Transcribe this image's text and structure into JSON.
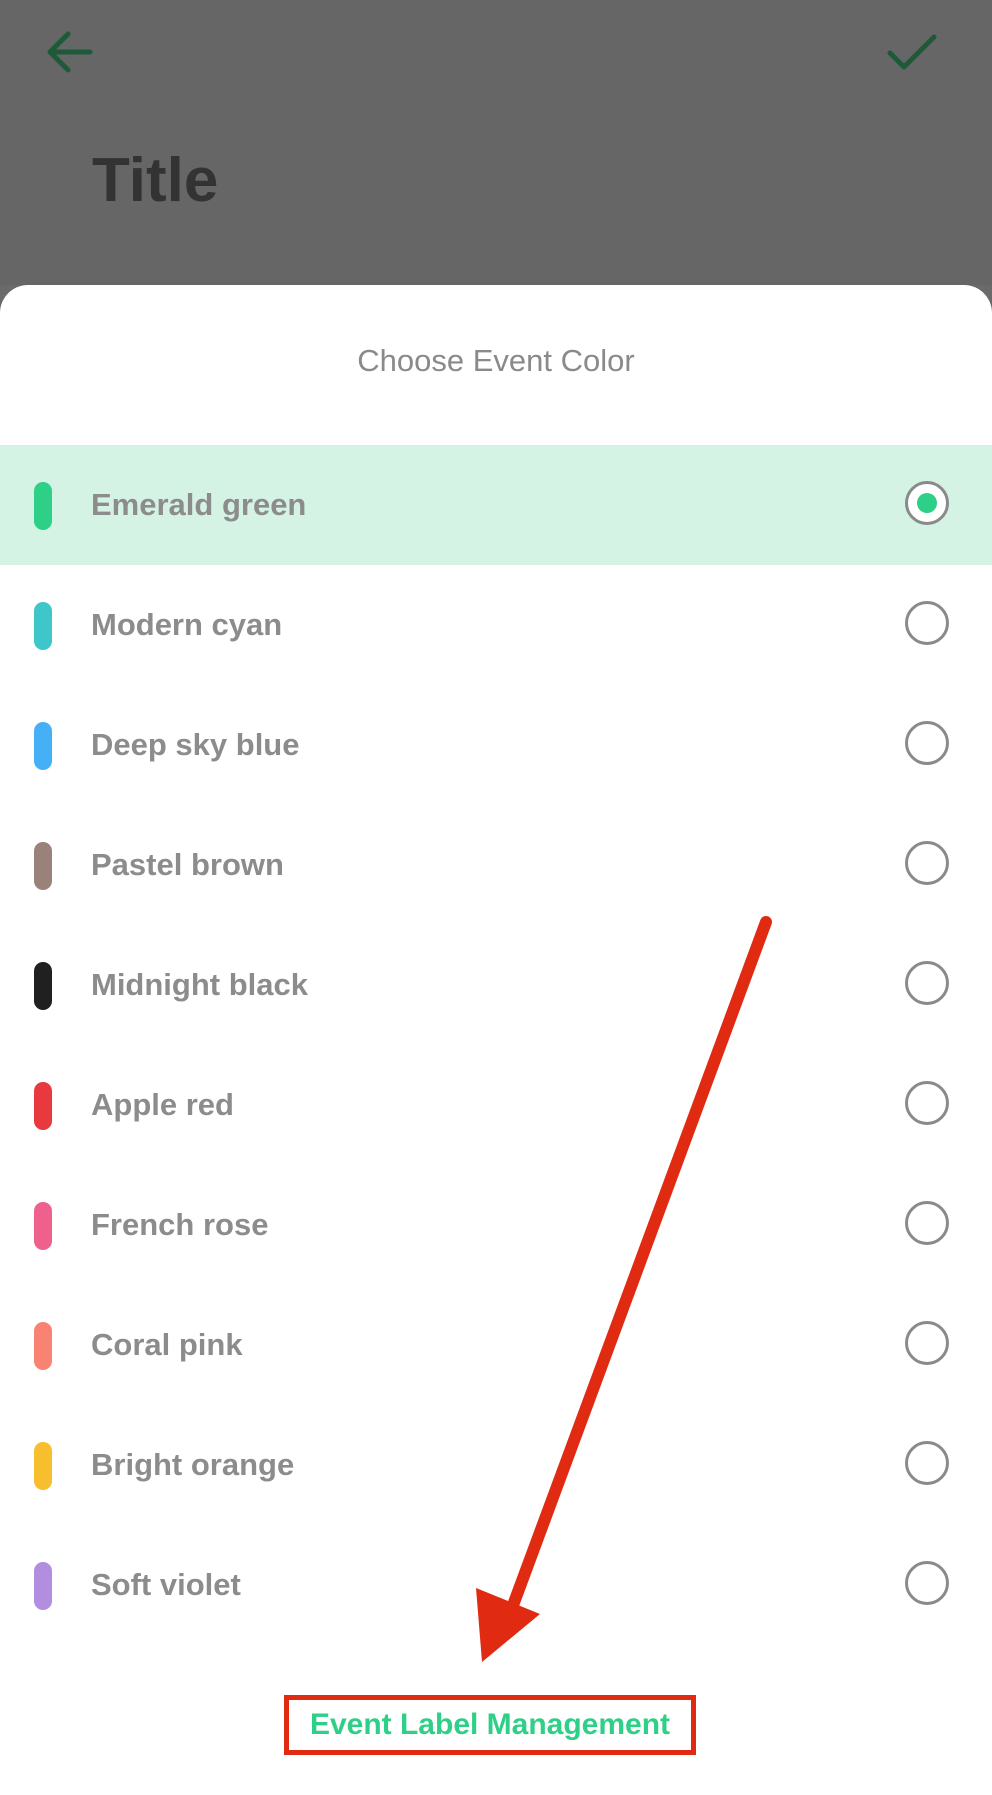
{
  "colors": {
    "accent": "#2ecf86",
    "dark_icon": "#1e5a3a",
    "annotation": "#e02b12"
  },
  "header": {
    "back_icon": "arrow-left-icon",
    "confirm_icon": "checkmark-icon",
    "title": "Title"
  },
  "sheet": {
    "title": "Choose Event Color",
    "items": [
      {
        "label": "Emerald green",
        "color": "#2ecf86",
        "selected": true
      },
      {
        "label": "Modern cyan",
        "color": "#3ec6c8",
        "selected": false
      },
      {
        "label": "Deep sky blue",
        "color": "#45b0f5",
        "selected": false
      },
      {
        "label": "Pastel brown",
        "color": "#9a817a",
        "selected": false
      },
      {
        "label": "Midnight black",
        "color": "#202020",
        "selected": false
      },
      {
        "label": "Apple red",
        "color": "#e8393e",
        "selected": false
      },
      {
        "label": "French rose",
        "color": "#f0608d",
        "selected": false
      },
      {
        "label": "Coral pink",
        "color": "#f98373",
        "selected": false
      },
      {
        "label": "Bright orange",
        "color": "#f7bf2d",
        "selected": false
      },
      {
        "label": "Soft violet",
        "color": "#b28ee0",
        "selected": false
      }
    ],
    "manage_label": "Event Label Management"
  }
}
